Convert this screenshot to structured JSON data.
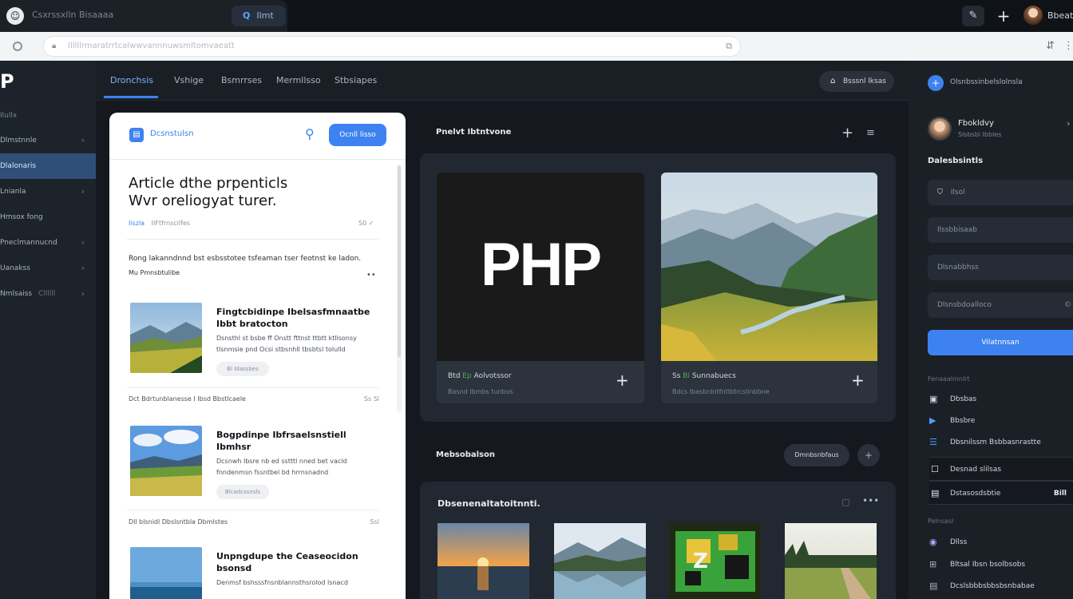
{
  "browser": {
    "tab_icon": "smiley-icon",
    "tab_title": "Csxrssxlln Bisaaaa",
    "tab_pill_label": "Ilmt",
    "user_label": "Bbeatlos",
    "address_text": "Illlllrmaratrrtcalwwvannnuwsmltomvaeatt",
    "icons": [
      "edit-icon",
      "plus-icon",
      "reload-icon",
      "lock-icon",
      "extension-icon",
      "translate-icon",
      "more-icon"
    ]
  },
  "leftnav": {
    "logo": "P",
    "heading": "Ilullx",
    "items": [
      {
        "label": "Dlmstnnle",
        "chevron": "›",
        "active": false
      },
      {
        "label": "Dlalonaris",
        "chevron": "",
        "active": true
      },
      {
        "label": "Lnianla",
        "chevron": "›",
        "active": false
      },
      {
        "label": "Hmsox fong",
        "chevron": "",
        "active": false
      },
      {
        "label": "Pneclmannucnd",
        "chevron": "›",
        "active": false
      },
      {
        "label": "Uanakss",
        "chevron": "›",
        "active": false
      },
      {
        "label": "Nmlsaiss",
        "extra": "Cllllll",
        "chevron": "›",
        "active": false
      }
    ]
  },
  "topbar": {
    "tabs": [
      {
        "label": "Dronchsis",
        "active": true
      },
      {
        "label": "Vshige",
        "active": false
      },
      {
        "label": "Bsmrrses",
        "active": false
      },
      {
        "label": "Mermllsso",
        "active": false
      },
      {
        "label": "Stbsiapes",
        "active": false
      }
    ],
    "button_label": "Bsssnl lksas"
  },
  "article": {
    "header_title": "Dcsnstulsn",
    "cta_label": "Ocnll lisso",
    "title_line1": "Article dthe prpenticls",
    "title_line2": "Wvr oreliogyat turer.",
    "meta_author": "Iiszla",
    "meta_text": "IIFtfrnscilfes",
    "meta_icons": "S0 ✓",
    "lead": "Rong lakanndnnd bst esbsstotee tsfeaman tser feotnst ke ladon.",
    "lead_sub": "Mu Pmnsbtulibe",
    "posts": [
      {
        "title": "Fingtcbidinpe Ibelsasfmnaatbe Ibbt bratocton",
        "body": "Dsnsthl st bsbe ff Onstt fttnst ttbtt ktllsonsy tlsnmsie pnd Ocsi stbsnhll tbsbtsl tolulld",
        "chip": "Bl Idassbes",
        "footer": "Dct Bdrtunblanesse I Ibsd Bbstlcaele",
        "footer_right": "Ss Sl"
      },
      {
        "title": "Bogpdinpe Ibfrsaelsnstiell Ibmhsr",
        "body": "Dcsnwh Ibsre nb ed sstttl nned bet vacld fnndenmsn fssntbel bd hrrnsnadnd",
        "chip": "Blcadcssnsls",
        "footer": "Dll blsnidl Dbslsntbla Dbmlstes",
        "footer_right": "Ssl"
      },
      {
        "title": "Unpngdupe the Ceaseocidon bsonsd",
        "body": "Denmsf bshsssfnsnblannsthsrolod lsnacd",
        "chip": "",
        "footer": "",
        "footer_right": ""
      }
    ]
  },
  "media": {
    "title": "Pnelvt Ibtntvone",
    "cards": [
      {
        "hero_text": "PHP",
        "caption": "Btd",
        "caption_tag": "Ep",
        "caption_rest": "Aolvotssor",
        "sub": "Basnd Ibmbs tunbos"
      },
      {
        "hero_text": "",
        "caption": "Ss",
        "caption_tag": "Bi",
        "caption_rest": "Sunnabuecs",
        "sub": "Bdcs Ibasbnlntfntlbtrcslinbbne"
      }
    ]
  },
  "lower": {
    "title": "Mebsobalson",
    "button_label": "Dmnbsnbfaus",
    "gallery_title": "Dbsenenaltatoitnnti.",
    "thumbs": [
      "sunset-sea",
      "mountain-lake",
      "pixel-art",
      "country-road"
    ]
  },
  "rightbar": {
    "top_text": "Olsnbssinbelslolnsla",
    "user_name": "Fbokldvy",
    "user_sub": "Slsbsbl Ibbles",
    "heading": "Dalesbsintls",
    "fields": [
      {
        "icon": "tag-icon",
        "label": "Ilsol",
        "right": ""
      },
      {
        "icon": "",
        "label": "Ilssbbisaab",
        "right": ""
      },
      {
        "icon": "",
        "label": "Dlsnabbhss",
        "right": ""
      },
      {
        "icon": "",
        "label": "Dlsnsbdoalloco",
        "right": "©"
      }
    ],
    "cta_label": "Vilatnnsan",
    "section1_label": "Fenaaalmnlrt",
    "items1": [
      {
        "icon": "folder-icon",
        "label": "Dbsbas"
      },
      {
        "icon": "video-icon",
        "label": "Bbsbre"
      },
      {
        "icon": "list-icon",
        "label": "Dbsnilssm Bsbbasnrastte"
      }
    ],
    "items_boxed": [
      {
        "icon": "square-icon",
        "label": "Desnad slilsas",
        "badge": ""
      },
      {
        "icon": "doc-icon",
        "label": "Dstasosdsbtie",
        "badge": "Bill"
      }
    ],
    "section2_label": "Pelnsasl",
    "items2": [
      {
        "icon": "chat-icon",
        "label": "Dllss"
      },
      {
        "icon": "grid-icon",
        "label": "Bltsal Ibsn bsolbsobs"
      },
      {
        "icon": "doc-icon",
        "label": "Dcslsbbbsbbsbsnbabae"
      }
    ]
  },
  "colors": {
    "accent": "#3d82f0",
    "background": "#15191f",
    "panel": "#222831",
    "card": "#2c333c"
  }
}
